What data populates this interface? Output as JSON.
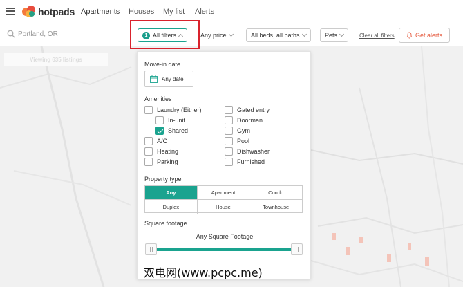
{
  "brand": {
    "name": "hotpads"
  },
  "nav": {
    "links": [
      "Apartments",
      "Houses",
      "My list",
      "Alerts"
    ]
  },
  "search": {
    "value": "Portland, OR"
  },
  "filters": {
    "all_filters_label": "All filters",
    "all_filters_count": "1",
    "price_label": "Any price",
    "beds_label": "All beds, all baths",
    "pets_label": "Pets",
    "clear_all_label": "Clear all filters",
    "get_alerts_label": "Get alerts"
  },
  "map": {
    "viewing_label": "Viewing 635 listings"
  },
  "panel": {
    "move_in": {
      "label": "Move-in date",
      "value": "Any date"
    },
    "amenities": {
      "label": "Amenities",
      "left": [
        {
          "label": "Laundry (Either)",
          "checked": false
        },
        {
          "label": "In-unit",
          "checked": false
        },
        {
          "label": "Shared",
          "checked": true
        },
        {
          "label": "A/C",
          "checked": false
        },
        {
          "label": "Heating",
          "checked": false
        },
        {
          "label": "Parking",
          "checked": false
        }
      ],
      "right": [
        {
          "label": "Gated entry",
          "checked": false
        },
        {
          "label": "Doorman",
          "checked": false
        },
        {
          "label": "Gym",
          "checked": false
        },
        {
          "label": "Pool",
          "checked": false
        },
        {
          "label": "Dishwasher",
          "checked": false
        },
        {
          "label": "Furnished",
          "checked": false
        }
      ]
    },
    "property_type": {
      "label": "Property type",
      "options": [
        "Any",
        "Apartment",
        "Condo",
        "Duplex",
        "House",
        "Townhouse"
      ],
      "selected": "Any"
    },
    "square_footage": {
      "label": "Square footage",
      "value": "Any Square Footage"
    }
  },
  "watermark": {
    "text": "双电网(www.pcpc.me)"
  },
  "colors": {
    "accent": "#1aa38f",
    "alert": "#e5573b",
    "highlight": "#d9232d"
  }
}
